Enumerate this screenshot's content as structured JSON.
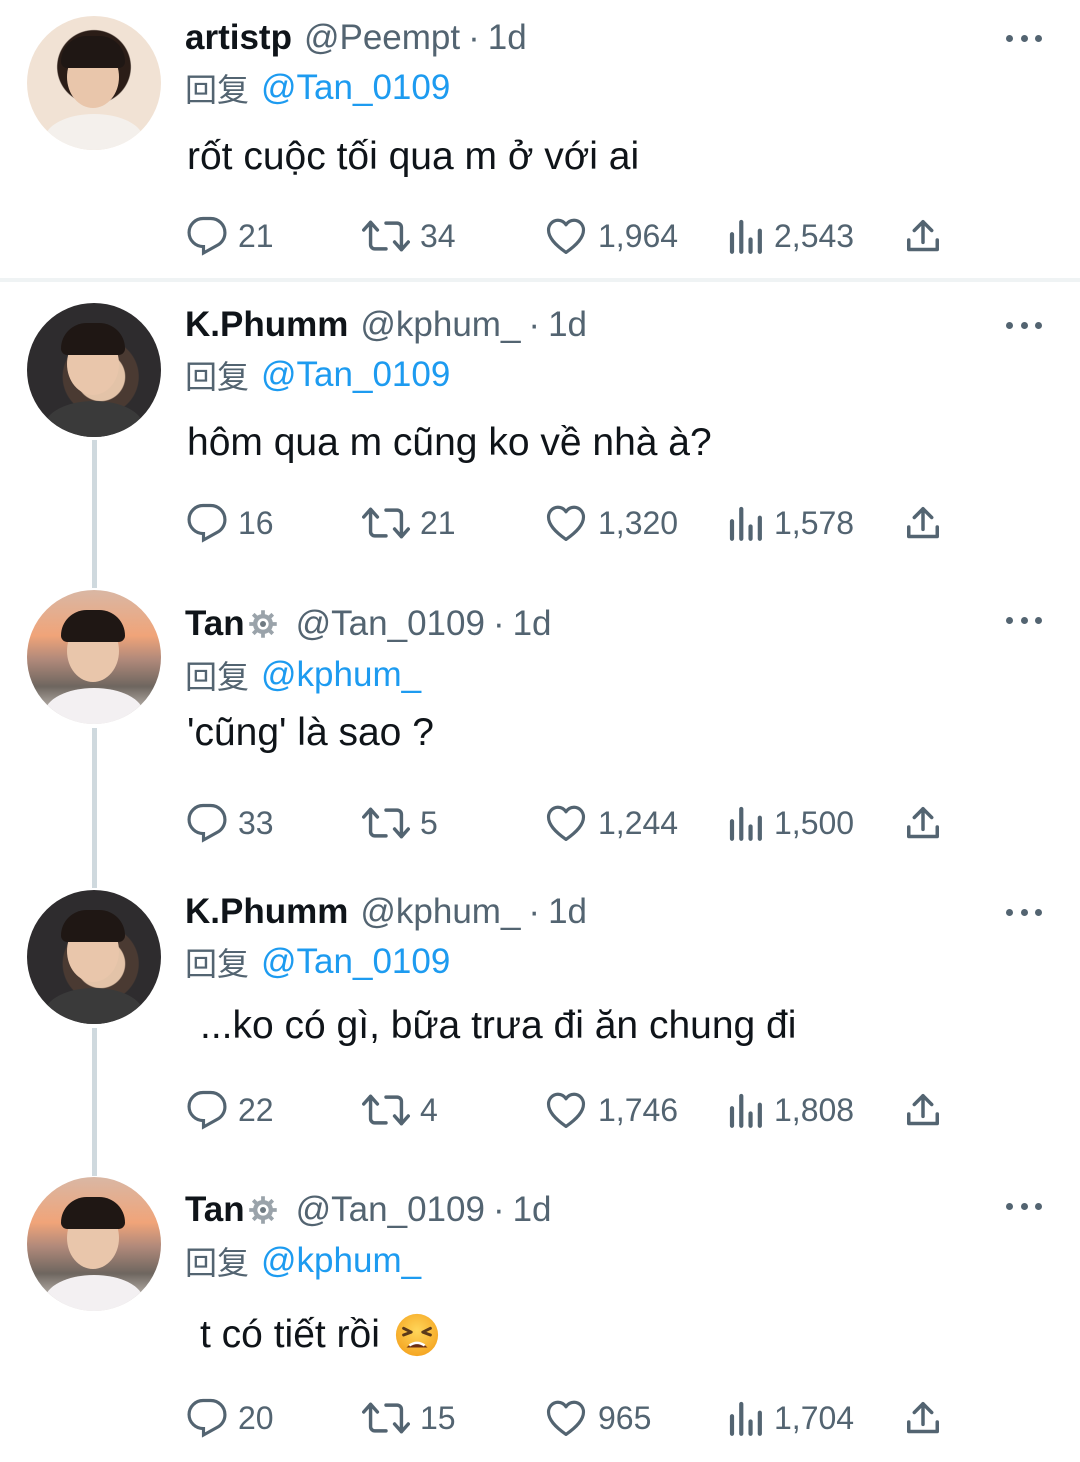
{
  "tweets": [
    {
      "name": "artistp",
      "handle": "@Peempt",
      "dot": "·",
      "time": "1d",
      "reply_prefix": "回复",
      "reply_to": "@Tan_0109",
      "text": "rốt cuộc tối qua m ở với ai",
      "replies": "21",
      "retweets": "34",
      "likes": "1,964",
      "views": "2,543"
    },
    {
      "name": "K.Phumm",
      "handle": "@kphum_",
      "dot": "·",
      "time": "1d",
      "reply_prefix": "回复",
      "reply_to": "@Tan_0109",
      "text": "hôm qua m cũng ko về nhà à?",
      "replies": "16",
      "retweets": "21",
      "likes": "1,320",
      "views": "1,578"
    },
    {
      "name": "Tan",
      "handle": "@Tan_0109",
      "dot": "·",
      "time": "1d",
      "reply_prefix": "回复",
      "reply_to": "@kphum_",
      "text": "'cũng' là sao ?",
      "replies": "33",
      "retweets": "5",
      "likes": "1,244",
      "views": "1,500"
    },
    {
      "name": "K.Phumm",
      "handle": "@kphum_",
      "dot": "·",
      "time": "1d",
      "reply_prefix": "回复",
      "reply_to": "@Tan_0109",
      "text": "...ko có gì, bữa trưa đi ăn chung đi",
      "replies": "22",
      "retweets": "4",
      "likes": "1,746",
      "views": "1,808"
    },
    {
      "name": "Tan",
      "handle": "@Tan_0109",
      "dot": "·",
      "time": "1d",
      "reply_prefix": "回复",
      "reply_to": "@kphum_",
      "text": "t có tiết rồi",
      "replies": "20",
      "retweets": "15",
      "likes": "965",
      "views": "1,704"
    }
  ],
  "icons": {
    "reply": "reply-icon",
    "retweet": "retweet-icon",
    "like": "heart-icon",
    "views": "views-icon",
    "share": "share-icon",
    "more": "more-icon",
    "badge": "gear-badge-icon",
    "emoji": "tired-face-emoji"
  },
  "colors": {
    "link": "#1d9bf0",
    "secondary_text": "#536471",
    "primary_text": "#0f1419"
  }
}
